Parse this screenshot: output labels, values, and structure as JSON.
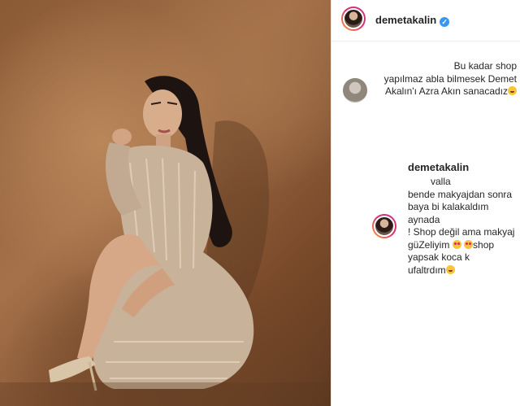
{
  "post": {
    "username": "demetakalin",
    "verified_icon": "verified-badge-icon",
    "photo_description_icon": "post-photo"
  },
  "comment_1": {
    "avatar_icon": "user-avatar",
    "lines": [
      "Bu kadar shop",
      "yapılmaz abla bilmesek Demet",
      "Akalın'ı Azra Akın sanacadız"
    ],
    "emoji": "smirk-emoji-icon"
  },
  "reply": {
    "username": "demetakalin",
    "lines": [
      "valla",
      "bende makyajdan sonra",
      "baya bi kalakaldım aynada",
      "! Shop değil ama makyaj",
      "güZeliyim",
      "shop",
      "yapsak koca k",
      "ufaltrdım"
    ],
    "emoji_icons": [
      "heart-eyes-emoji-icon",
      "heart-eyes-emoji-icon",
      "laughing-emoji-icon"
    ]
  },
  "colors": {
    "username": "#262626",
    "verified": "#3897f0",
    "divider": "#e6e6e6",
    "photo_bg": "#9a6a42"
  }
}
